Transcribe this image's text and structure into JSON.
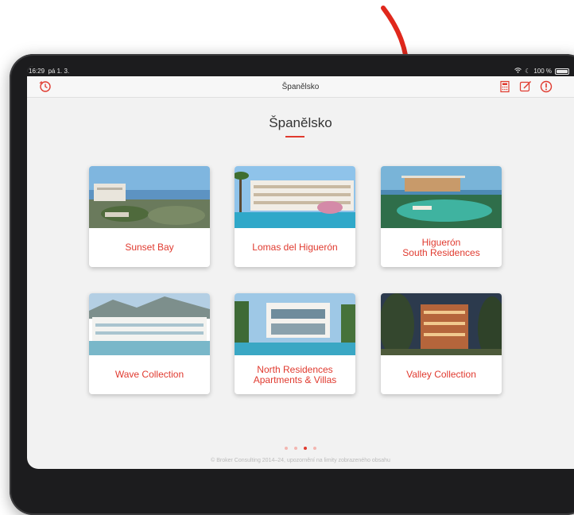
{
  "status_bar": {
    "time": "16:29",
    "date": "pá 1. 3.",
    "battery": "100 %"
  },
  "nav": {
    "title": "Španělsko",
    "left_icon": "refresh-clock-icon",
    "right_icons": [
      "calculator-icon",
      "edit-icon",
      "alert-icon"
    ]
  },
  "page": {
    "heading": "Španělsko",
    "accent_color": "#e03a2f"
  },
  "cards": [
    {
      "label": "Sunset Bay"
    },
    {
      "label": "Lomas del Higuerón"
    },
    {
      "label": "Higuerón\nSouth Residences"
    },
    {
      "label": "Wave Collection"
    },
    {
      "label": "North Residences\nApartments & Villas"
    },
    {
      "label": "Valley Collection"
    }
  ],
  "pagination": {
    "pages": 4,
    "current": 3
  },
  "footer": "© Broker Consulting 2014–24, upozornění na limity zobrazeného obsahu"
}
